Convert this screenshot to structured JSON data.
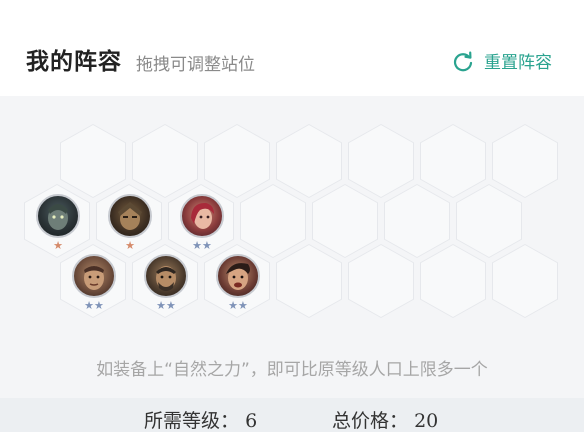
{
  "header": {
    "title": "我的阵容",
    "subtitle": "拖拽可调整站位",
    "reset_label": "重置阵容",
    "accent": "#2aa38f"
  },
  "board": {
    "units": [
      {
        "name": "unit-1",
        "stars": "★",
        "star_color": "#d58a6a"
      },
      {
        "name": "unit-2",
        "stars": "★",
        "star_color": "#d58a6a"
      },
      {
        "name": "unit-3",
        "stars": "★★",
        "star_color": "#7f93b8"
      },
      {
        "name": "unit-4",
        "stars": "★★",
        "star_color": "#7f93b8"
      },
      {
        "name": "unit-5",
        "stars": "★★",
        "star_color": "#7f93b8"
      },
      {
        "name": "unit-6",
        "stars": "★★",
        "star_color": "#7f93b8"
      }
    ]
  },
  "note": "如装备上“自然之力”，即可比原等级人口上限多一个",
  "footer": {
    "level_label": "所需等级：",
    "level_value": "6",
    "price_label": "总价格：",
    "price_value": "20"
  }
}
